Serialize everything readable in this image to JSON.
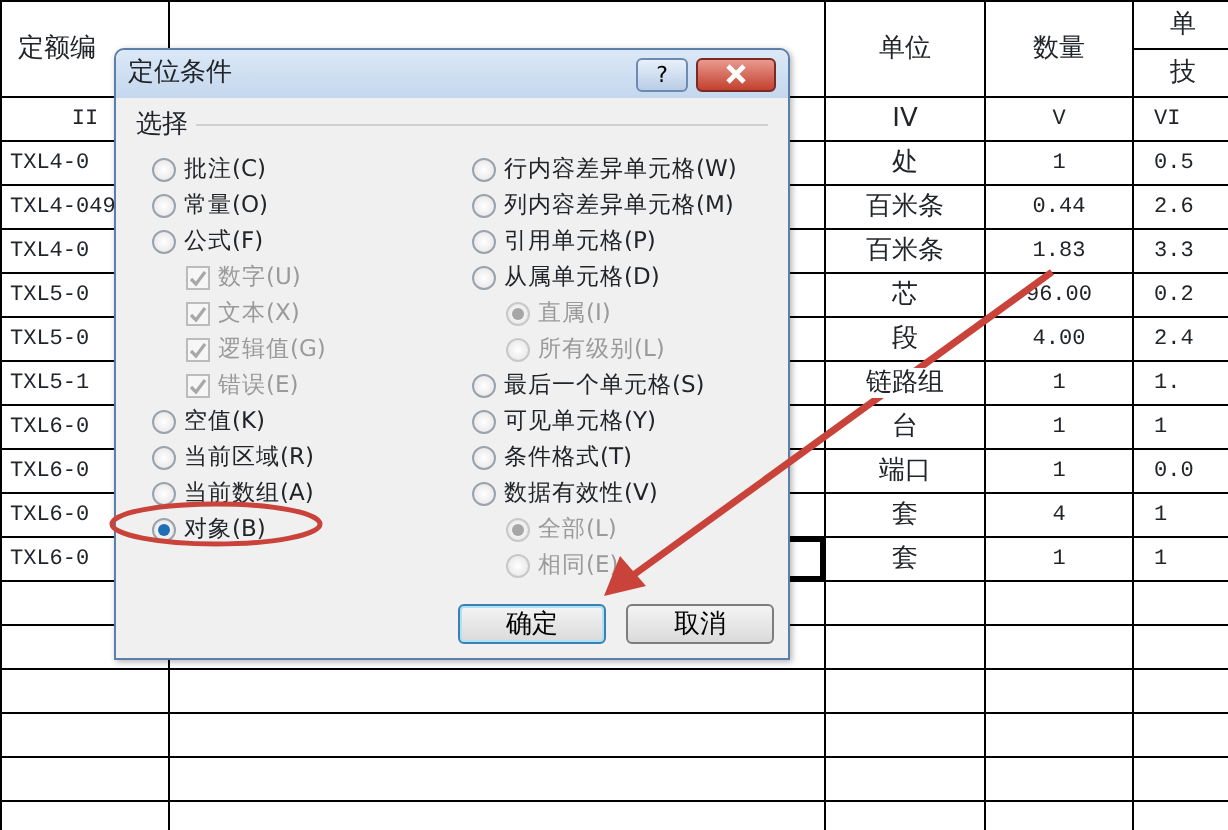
{
  "sheet": {
    "header": {
      "code": "定额编",
      "unit": "单位",
      "qty": "数量",
      "col_5": "单",
      "col_5_sub": "技"
    },
    "rows": [
      {
        "code": "II",
        "unit": "IV",
        "qty": "V",
        "col_5": "VI",
        "active": false
      },
      {
        "code": "TXL4-0",
        "unit": "处",
        "qty": "1",
        "col_5": "0.5",
        "active": false
      },
      {
        "code": "TXL4-049",
        "unit": "百米条",
        "qty": "0.44",
        "col_5": "2.6",
        "active": false
      },
      {
        "code": "TXL4-0",
        "unit": "百米条",
        "qty": "1.83",
        "col_5": "3.3",
        "active": false
      },
      {
        "code": "TXL5-0",
        "unit": "芯",
        "qty": "96.00",
        "col_5": "0.2",
        "active": false
      },
      {
        "code": "TXL5-0",
        "unit": "段",
        "qty": "4.00",
        "col_5": "2.4",
        "active": false
      },
      {
        "code": "TXL5-1",
        "unit": "链路组",
        "qty": "1",
        "col_5": "1.",
        "active": false
      },
      {
        "code": "TXL6-0",
        "unit": "台",
        "qty": "1",
        "col_5": "1",
        "active": false
      },
      {
        "code": "TXL6-0",
        "unit": "端口",
        "qty": "1",
        "col_5": "0.0",
        "active": false
      },
      {
        "code": "TXL6-0",
        "unit": "套",
        "qty": "4",
        "col_5": "1",
        "active": false
      },
      {
        "code": "TXL6-0",
        "unit": "套",
        "qty": "1",
        "col_5": "1",
        "active": true
      }
    ]
  },
  "dialog": {
    "title": "定位条件",
    "help": "?",
    "group": "选择",
    "left": [
      {
        "kind": "radio",
        "label": "批注(C)",
        "selected": false,
        "disabled": false
      },
      {
        "kind": "radio",
        "label": "常量(O)",
        "selected": false,
        "disabled": false
      },
      {
        "kind": "radio",
        "label": "公式(F)",
        "selected": false,
        "disabled": false,
        "children": [
          {
            "kind": "check",
            "label": "数字(U)",
            "checked": true,
            "disabled": true
          },
          {
            "kind": "check",
            "label": "文本(X)",
            "checked": true,
            "disabled": true
          },
          {
            "kind": "check",
            "label": "逻辑值(G)",
            "checked": true,
            "disabled": true
          },
          {
            "kind": "check",
            "label": "错误(E)",
            "checked": true,
            "disabled": true
          }
        ]
      },
      {
        "kind": "radio",
        "label": "空值(K)",
        "selected": false,
        "disabled": false
      },
      {
        "kind": "radio",
        "label": "当前区域(R)",
        "selected": false,
        "disabled": false
      },
      {
        "kind": "radio",
        "label": "当前数组(A)",
        "selected": false,
        "disabled": false
      },
      {
        "kind": "radio",
        "label": "对象(B)",
        "selected": true,
        "disabled": false
      }
    ],
    "right": [
      {
        "kind": "radio",
        "label": "行内容差异单元格(W)",
        "selected": false,
        "disabled": false
      },
      {
        "kind": "radio",
        "label": "列内容差异单元格(M)",
        "selected": false,
        "disabled": false
      },
      {
        "kind": "radio",
        "label": "引用单元格(P)",
        "selected": false,
        "disabled": false
      },
      {
        "kind": "radio",
        "label": "从属单元格(D)",
        "selected": false,
        "disabled": false,
        "children": [
          {
            "kind": "radio",
            "label": "直属(I)",
            "selected": true,
            "disabled": true
          },
          {
            "kind": "radio",
            "label": "所有级别(L)",
            "selected": false,
            "disabled": true
          }
        ]
      },
      {
        "kind": "radio",
        "label": "最后一个单元格(S)",
        "selected": false,
        "disabled": false
      },
      {
        "kind": "radio",
        "label": "可见单元格(Y)",
        "selected": false,
        "disabled": false
      },
      {
        "kind": "radio",
        "label": "条件格式(T)",
        "selected": false,
        "disabled": false
      },
      {
        "kind": "radio",
        "label": "数据有效性(V)",
        "selected": false,
        "disabled": false,
        "children": [
          {
            "kind": "radio",
            "label": "全部(L)",
            "selected": true,
            "disabled": true
          },
          {
            "kind": "radio",
            "label": "相同(E)",
            "selected": false,
            "disabled": true
          }
        ]
      }
    ],
    "buttons": [
      {
        "label": "确定",
        "default": true
      },
      {
        "label": "取消",
        "default": false
      }
    ]
  }
}
